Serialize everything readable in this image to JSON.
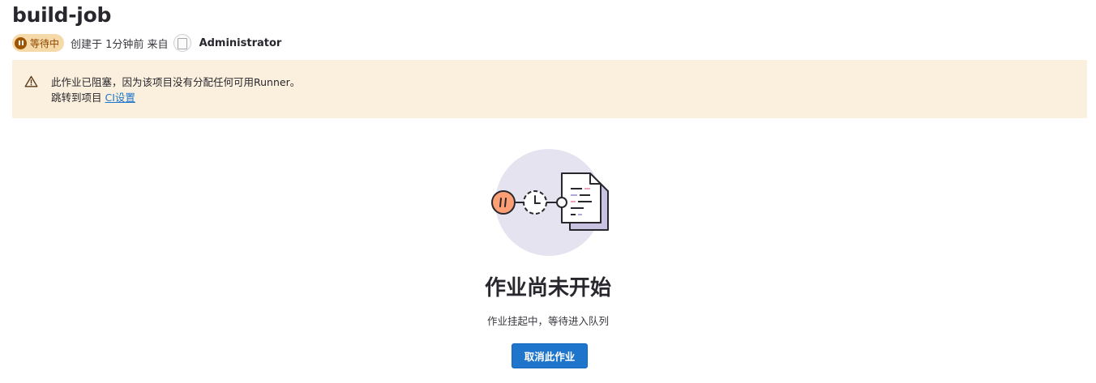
{
  "header": {
    "title": "build-job",
    "status_badge": "等待中",
    "created_text": "创建于 1分钟前 来自",
    "author": "Administrator"
  },
  "alert": {
    "message": "此作业已阻塞，因为该项目没有分配任何可用Runner。",
    "jump_prefix": "跳转到项目",
    "link_label": "CI设置",
    "icon": "warning-icon"
  },
  "empty_state": {
    "title": "作业尚未开始",
    "description": "作业挂起中，等待进入队列",
    "cancel_button": "取消此作业"
  },
  "colors": {
    "badge_bg": "#f5d9a8",
    "badge_text": "#8f4700",
    "alert_bg": "#fbefdd",
    "primary": "#1f75cb",
    "illustration_circle": "#e6e3f1",
    "pause_fill": "#fc9f75"
  }
}
